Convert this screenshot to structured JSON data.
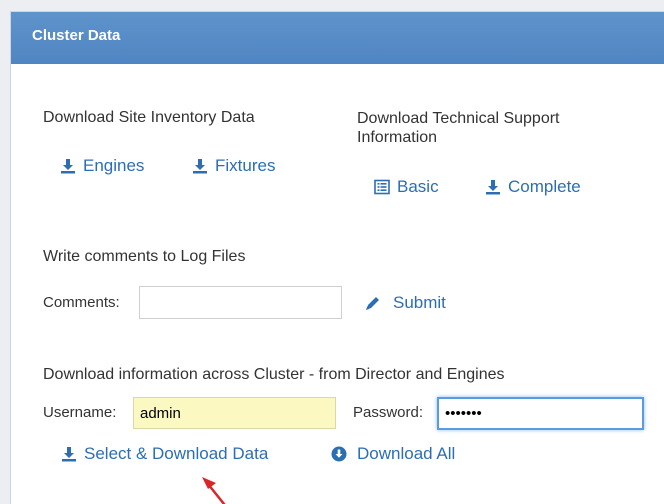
{
  "panel": {
    "title": "Cluster Data"
  },
  "inventory": {
    "heading": "Download Site Inventory Data",
    "engines_label": "Engines",
    "fixtures_label": "Fixtures"
  },
  "support": {
    "heading": "Download Technical Support Information",
    "basic_label": "Basic",
    "complete_label": "Complete"
  },
  "logs": {
    "heading": "Write comments to Log Files",
    "comments_label": "Comments:",
    "comments_value": "",
    "submit_label": "Submit"
  },
  "cluster": {
    "heading": "Download information across Cluster - from Director and Engines",
    "username_label": "Username:",
    "username_value": "admin",
    "password_label": "Password:",
    "password_value": "•••••••",
    "select_download_label": "Select & Download Data",
    "download_all_label": "Download All"
  },
  "colors": {
    "header_bg": "#5389c5",
    "link": "#2c6eb4",
    "autofill_bg": "#fbf8c2",
    "arrow": "#d9262a"
  }
}
